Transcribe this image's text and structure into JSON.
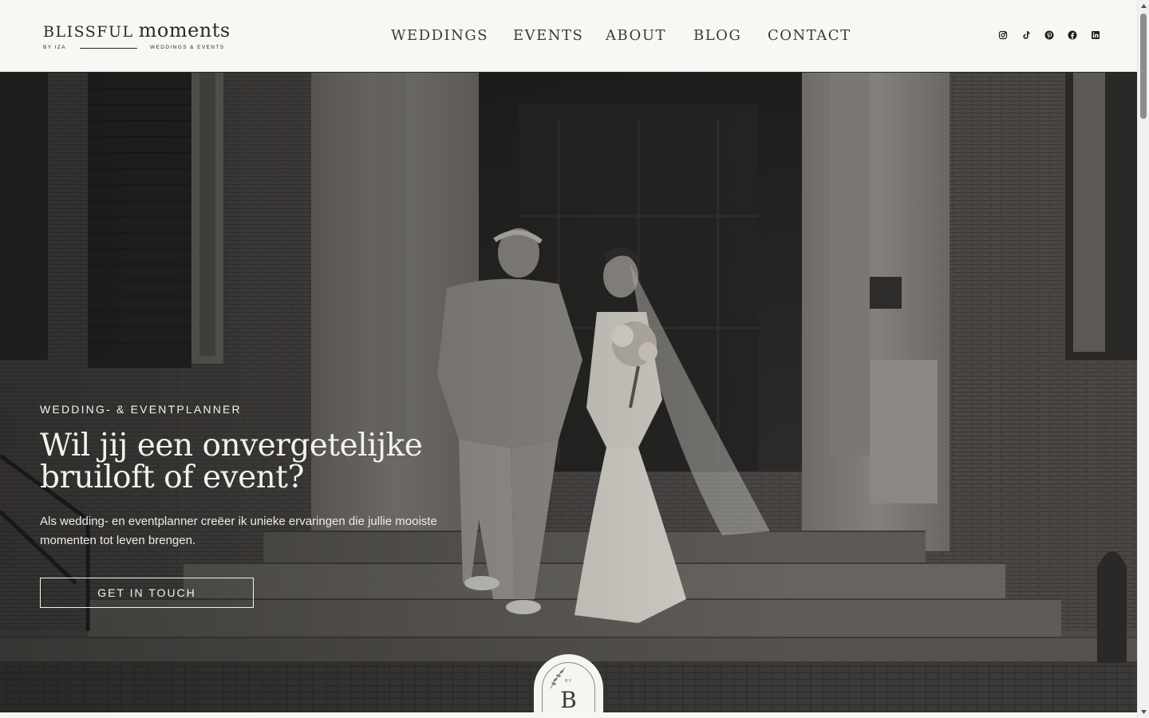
{
  "brand": {
    "name_part1": "BLISSFUL",
    "name_part2": "moments",
    "tagline_left": "BY IZA",
    "tagline_right": "WEDDINGS & EVENTS"
  },
  "nav": {
    "items": [
      {
        "label": "WEDDINGS"
      },
      {
        "label": "EVENTS"
      },
      {
        "label": "ABOUT"
      },
      {
        "label": "BLOG"
      },
      {
        "label": "CONTACT"
      }
    ]
  },
  "social": {
    "icons": [
      "instagram-icon",
      "tiktok-icon",
      "pinterest-icon",
      "facebook-icon",
      "linkedin-icon"
    ]
  },
  "hero": {
    "eyebrow": "WEDDING- & EVENTPLANNER",
    "headline": "Wil jij een onvergetelijke bruiloft of event?",
    "lead": "Als wedding- en eventplanner creëer ik unieke ervaringen die jullie mooiste momenten tot leven brengen.",
    "cta_label": "GET IN TOUCH"
  },
  "badge": {
    "small_text": "BY",
    "letter": "B"
  },
  "colors": {
    "header_bg": "#f7f7f3",
    "text_dark": "#2a2a2a",
    "hero_text": "#f4f2ec"
  }
}
